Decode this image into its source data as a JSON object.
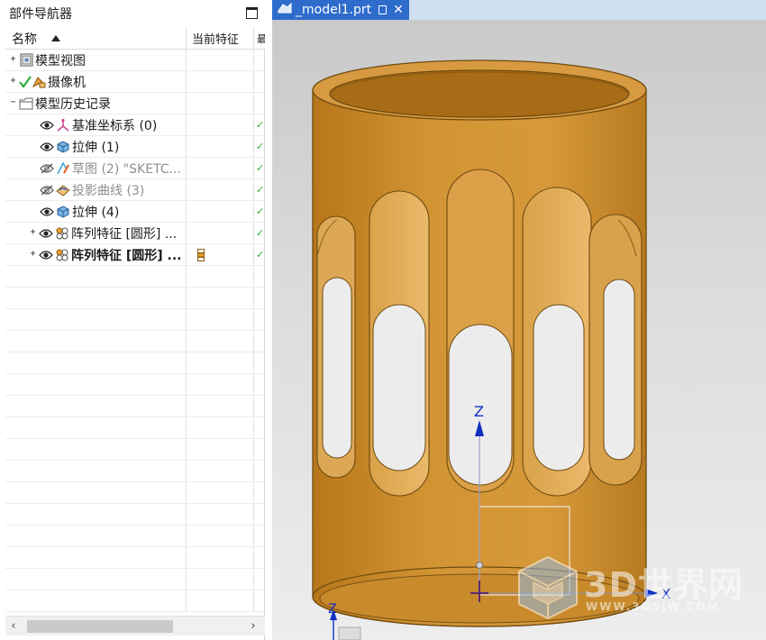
{
  "navigator": {
    "title": "部件导航器",
    "columns": {
      "name": "名称",
      "current_feature": "当前特征",
      "third": "最"
    },
    "rows": [
      {
        "expander": "+",
        "icon": "model-views-icon",
        "label": "模型视图",
        "style": "normal",
        "current": "",
        "check": ""
      },
      {
        "expander": "+",
        "icon": "camera-icon",
        "label": "摄像机",
        "style": "normal",
        "current": "",
        "check": ""
      },
      {
        "expander": "−",
        "icon": "folder-icon",
        "label": "模型历史记录",
        "style": "normal",
        "current": "",
        "check": ""
      },
      {
        "expander": "",
        "icon": "datum-csys-icon",
        "label": "基准坐标系 (0)",
        "style": "normal",
        "current": "",
        "check": "✓"
      },
      {
        "expander": "",
        "icon": "extrude-icon",
        "label": "拉伸 (1)",
        "style": "normal",
        "current": "",
        "check": "✓"
      },
      {
        "expander": "",
        "icon": "sketch-icon",
        "label": "草图 (2) \"SKETC...",
        "style": "dim",
        "current": "",
        "check": "✓"
      },
      {
        "expander": "",
        "icon": "projected-curve-icon",
        "label": "投影曲线 (3)",
        "style": "dim",
        "current": "",
        "check": "✓"
      },
      {
        "expander": "",
        "icon": "extrude-icon",
        "label": "拉伸 (4)",
        "style": "normal",
        "current": "",
        "check": "✓"
      },
      {
        "expander": "+",
        "icon": "pattern-feature-icon",
        "label": "阵列特征 [圆形] ...",
        "style": "normal",
        "current": "",
        "check": "✓"
      },
      {
        "expander": "+",
        "icon": "pattern-feature-icon",
        "label": "阵列特征 [圆形] ...",
        "style": "bold",
        "current": "current-feature-icon",
        "check": "✓"
      }
    ]
  },
  "viewport": {
    "tab_title": "_model1.prt",
    "axis_z_label": "Z",
    "axis_x_label": "X",
    "axis_z2_label": "Z",
    "watermark_text": "3D世界网",
    "watermark_url": "WWW.3DSJW.COM"
  },
  "colors": {
    "tab_active": "#2e6ccc",
    "part_body": "#c8861f",
    "axis_blue": "#1030c0"
  }
}
